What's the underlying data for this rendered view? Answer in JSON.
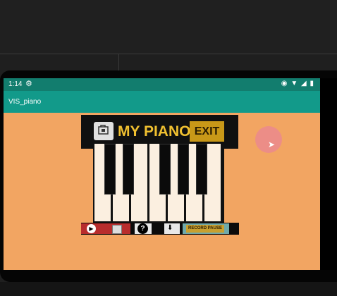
{
  "status": {
    "time": "1:14",
    "gear_icon": "gear-icon",
    "right_icons": "location-icon wifi-icon signal-icon battery-icon"
  },
  "app": {
    "title": "VIS_piano"
  },
  "piano": {
    "title": "MY PIANO",
    "exit_label": "EXIT",
    "open_icon": "folder-open-icon",
    "record_label": "RECORD PAUSE",
    "help_label": "?",
    "colors": {
      "background": "#f2a562",
      "title": "#f0c030",
      "exit": "#c89818",
      "play_segment": "#b82d2d",
      "record_segment": "#6fa9aa"
    }
  }
}
